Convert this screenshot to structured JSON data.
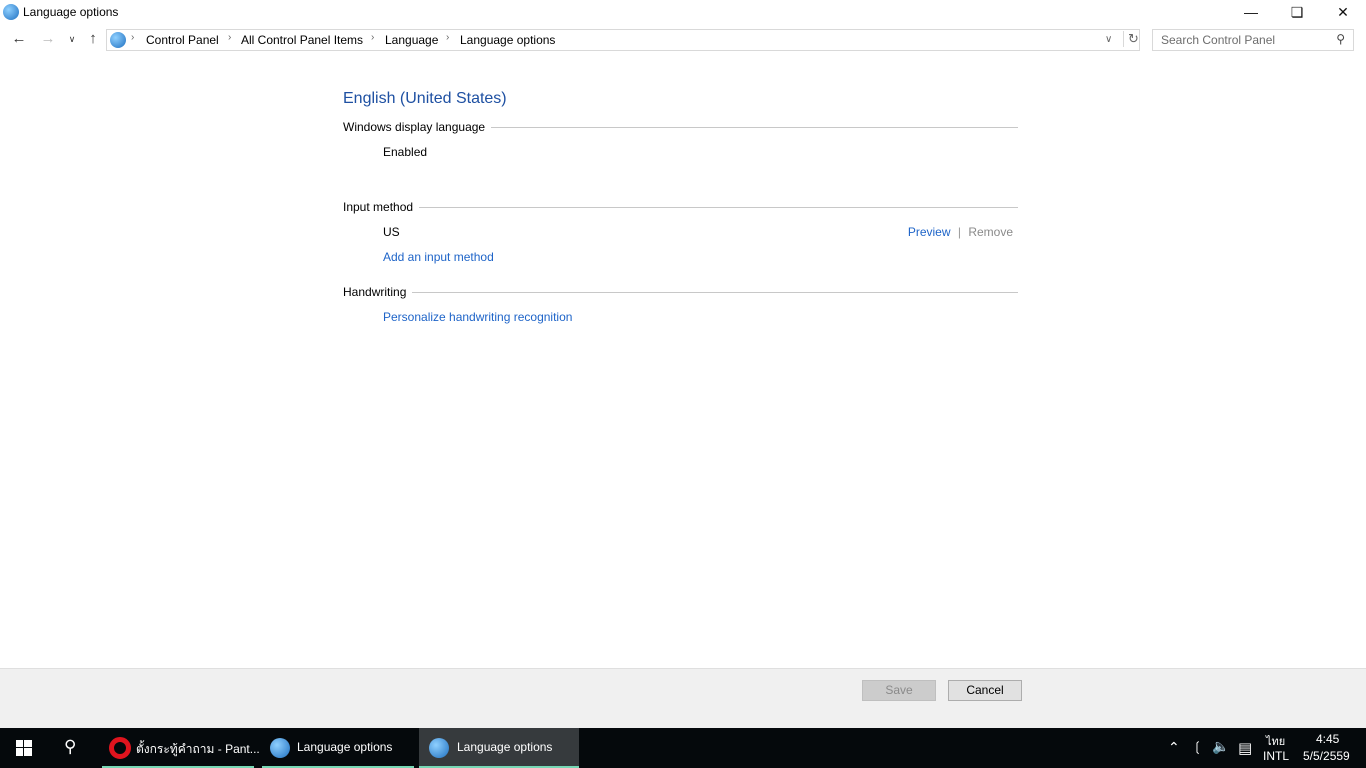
{
  "window": {
    "title": "Language options"
  },
  "nav": {
    "breadcrumbs": [
      "Control Panel",
      "All Control Panel Items",
      "Language",
      "Language options"
    ],
    "search_placeholder": "Search Control Panel"
  },
  "main": {
    "language": "English (United States)",
    "display_section": "Windows display language",
    "display_status": "Enabled",
    "input_section": "Input method",
    "input_name": "US",
    "preview": "Preview",
    "remove": "Remove",
    "add_input": "Add an input method",
    "handwriting_section": "Handwriting",
    "personalize": "Personalize handwriting recognition"
  },
  "footer": {
    "save": "Save",
    "cancel": "Cancel"
  },
  "taskbar": {
    "tasks": [
      "ตั้งกระทู้คำถาม - Pant...",
      "Language options",
      "Language options"
    ],
    "lang": "ไทย",
    "layout": "INTL",
    "time": "4:45",
    "date": "5/5/2559"
  }
}
